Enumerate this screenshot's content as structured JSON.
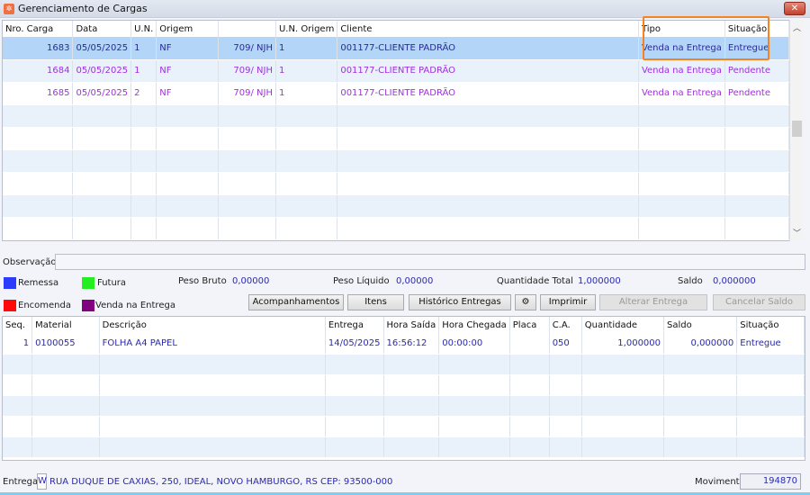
{
  "window": {
    "title": "Gerenciamento de Cargas",
    "close": "✕"
  },
  "cargas": {
    "columns": [
      "Nro. Carga",
      "Data",
      "U.N.",
      "Origem",
      "",
      "U.N. Origem",
      "Cliente",
      "Tipo",
      "Situação"
    ],
    "rows": [
      [
        "1683",
        "05/05/2025",
        "1",
        "NF",
        "709/ NJH",
        "1",
        "001177-CLIENTE PADRÃO",
        "Venda na Entrega",
        "Entregue"
      ],
      [
        "1684",
        "05/05/2025",
        "1",
        "NF",
        "709/ NJH",
        "1",
        "001177-CLIENTE PADRÃO",
        "Venda na Entrega",
        "Pendente"
      ],
      [
        "1685",
        "05/05/2025",
        "2",
        "NF",
        "709/ NJH",
        "1",
        "001177-CLIENTE PADRÃO",
        "Venda na Entrega",
        "Pendente"
      ]
    ]
  },
  "observacao": {
    "label": "Observação",
    "value": ""
  },
  "legend": [
    {
      "label": "Remessa",
      "color": "#2b3cff"
    },
    {
      "label": "Futura",
      "color": "#22ee22"
    },
    {
      "label": "Encomenda",
      "color": "#ff0a0a"
    },
    {
      "label": "Venda na Entrega",
      "color": "#800080"
    }
  ],
  "totals": {
    "peso_bruto_label": "Peso Bruto",
    "peso_bruto": "0,00000",
    "peso_liquido_label": "Peso Líquido",
    "peso_liquido": "0,00000",
    "qtd_total_label": "Quantidade Total",
    "qtd_total": "1,000000",
    "saldo_label": "Saldo",
    "saldo": "0,000000"
  },
  "buttons": {
    "acompanhamentos": "Acompanhamentos",
    "itens": "Itens",
    "historico": "Histórico Entregas",
    "gear": "⚙",
    "imprimir": "Imprimir",
    "alterar": "Alterar Entrega",
    "cancelar": "Cancelar Saldo"
  },
  "itens": {
    "columns": [
      "Seq.",
      "Material",
      "Descrição",
      "Entrega",
      "Hora Saída",
      "Hora Chegada",
      "Placa",
      "C.A.",
      "Quantidade",
      "Saldo",
      "Situação"
    ],
    "rows": [
      [
        "1",
        "0100055",
        "FOLHA A4 PAPEL",
        "14/05/2025",
        "16:56:12",
        "00:00:00",
        "",
        "050",
        "1,000000",
        "0,000000",
        "Entregue"
      ]
    ]
  },
  "footer": {
    "entrega_label": "Entrega",
    "entrega_code": "W",
    "endereco": "RUA DUQUE DE CAXIAS, 250, IDEAL, NOVO HAMBURGO, RS CEP: 93500-000",
    "movimento_label": "Movimento",
    "movimento": "194870"
  }
}
